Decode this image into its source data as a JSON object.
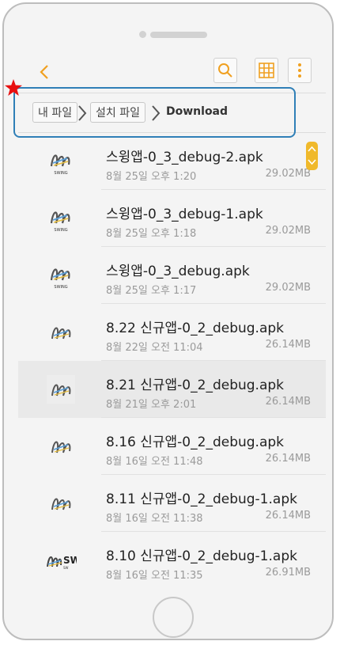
{
  "toolbar": {
    "back_icon": "chevron-left-icon",
    "search_icon": "search-icon",
    "grid_icon": "grid-view-icon",
    "more_icon": "more-vertical-icon",
    "accent": "#f0a020"
  },
  "breadcrumb": {
    "items": [
      "내 파일",
      "설치 파일"
    ],
    "current": "Download"
  },
  "files": [
    {
      "name": "스윙앱-0_3_debug-2.apk",
      "date": "8월 25일 오후 1:20",
      "size": "29.02MB"
    },
    {
      "name": "스윙앱-0_3_debug-1.apk",
      "date": "8월 25일 오후 1:18",
      "size": "29.02MB"
    },
    {
      "name": "스윙앱-0_3_debug.apk",
      "date": "8월 25일 오후 1:17",
      "size": "29.02MB"
    },
    {
      "name": "8.22 신규앱-0_2_debug.apk",
      "date": "8월 22일 오전 11:04",
      "size": "26.14MB"
    },
    {
      "name": "8.21 신규앱-0_2_debug.apk",
      "date": "8월 21일 오후 2:01",
      "size": "26.14MB"
    },
    {
      "name": "8.16 신규앱-0_2_debug.apk",
      "date": "8월 16일 오전 11:48",
      "size": "26.14MB"
    },
    {
      "name": "8.11 신규앱-0_2_debug-1.apk",
      "date": "8월 16일 오전 11:38",
      "size": "26.14MB"
    },
    {
      "name": "8.10 신규앱-0_2_debug-1.apk",
      "date": "8월 16일 오전 11:35",
      "size": "26.91MB"
    }
  ],
  "logo_texts": {
    "swing_small": "SWING",
    "sw": "SW"
  },
  "highlight_color": "#2f7fb7",
  "star_color": "#e81010"
}
